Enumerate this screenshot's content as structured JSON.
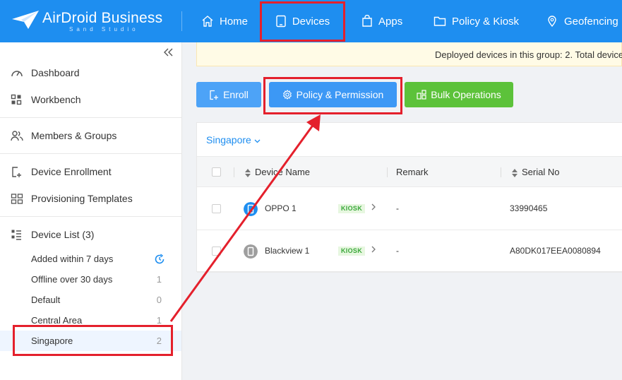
{
  "brand": {
    "name": "AirDroid Business",
    "subtitle": "Sand Studio"
  },
  "nav": [
    {
      "label": "Home",
      "icon": "home-icon"
    },
    {
      "label": "Devices",
      "icon": "tablet-icon"
    },
    {
      "label": "Apps",
      "icon": "bag-icon"
    },
    {
      "label": "Policy & Kiosk",
      "icon": "folder-icon"
    },
    {
      "label": "Geofencing",
      "icon": "map-pin-icon"
    }
  ],
  "sidebar": {
    "items": [
      {
        "label": "Dashboard",
        "icon": "dashboard-icon"
      },
      {
        "label": "Workbench",
        "icon": "workbench-icon"
      },
      {
        "label": "Members & Groups",
        "icon": "members-icon"
      },
      {
        "label": "Device Enrollment",
        "icon": "device-enroll-icon"
      },
      {
        "label": "Provisioning Templates",
        "icon": "template-icon"
      },
      {
        "label": "Device List (3)",
        "icon": "list-icon"
      }
    ],
    "groups": [
      {
        "label": "Added within 7 days",
        "count": ""
      },
      {
        "label": "Offline over 30 days",
        "count": "1"
      },
      {
        "label": "Default",
        "count": "0"
      },
      {
        "label": "Central Area",
        "count": "1"
      },
      {
        "label": "Singapore",
        "count": "2"
      }
    ]
  },
  "notice": {
    "text": "Deployed devices in this group: 2. Total device"
  },
  "toolbar": {
    "enroll": "Enroll",
    "policy": "Policy & Permission",
    "bulk": "Bulk Operations"
  },
  "group_selector": {
    "value": "Singapore"
  },
  "table": {
    "headers": {
      "name": "Device Name",
      "remark": "Remark",
      "serial": "Serial No"
    },
    "rows": [
      {
        "name": "OPPO 1",
        "badge": "KIOSK",
        "remark": "-",
        "serial": "33990465",
        "status_color": "#1e8ef0"
      },
      {
        "name": "Blackview 1",
        "badge": "KIOSK",
        "remark": "-",
        "serial": "A80DK017EEA0080894",
        "status_color": "#9e9e9e"
      }
    ]
  },
  "colors": {
    "primary": "#1e8ef0",
    "success": "#5cc23a",
    "annotation": "#e4202c"
  }
}
